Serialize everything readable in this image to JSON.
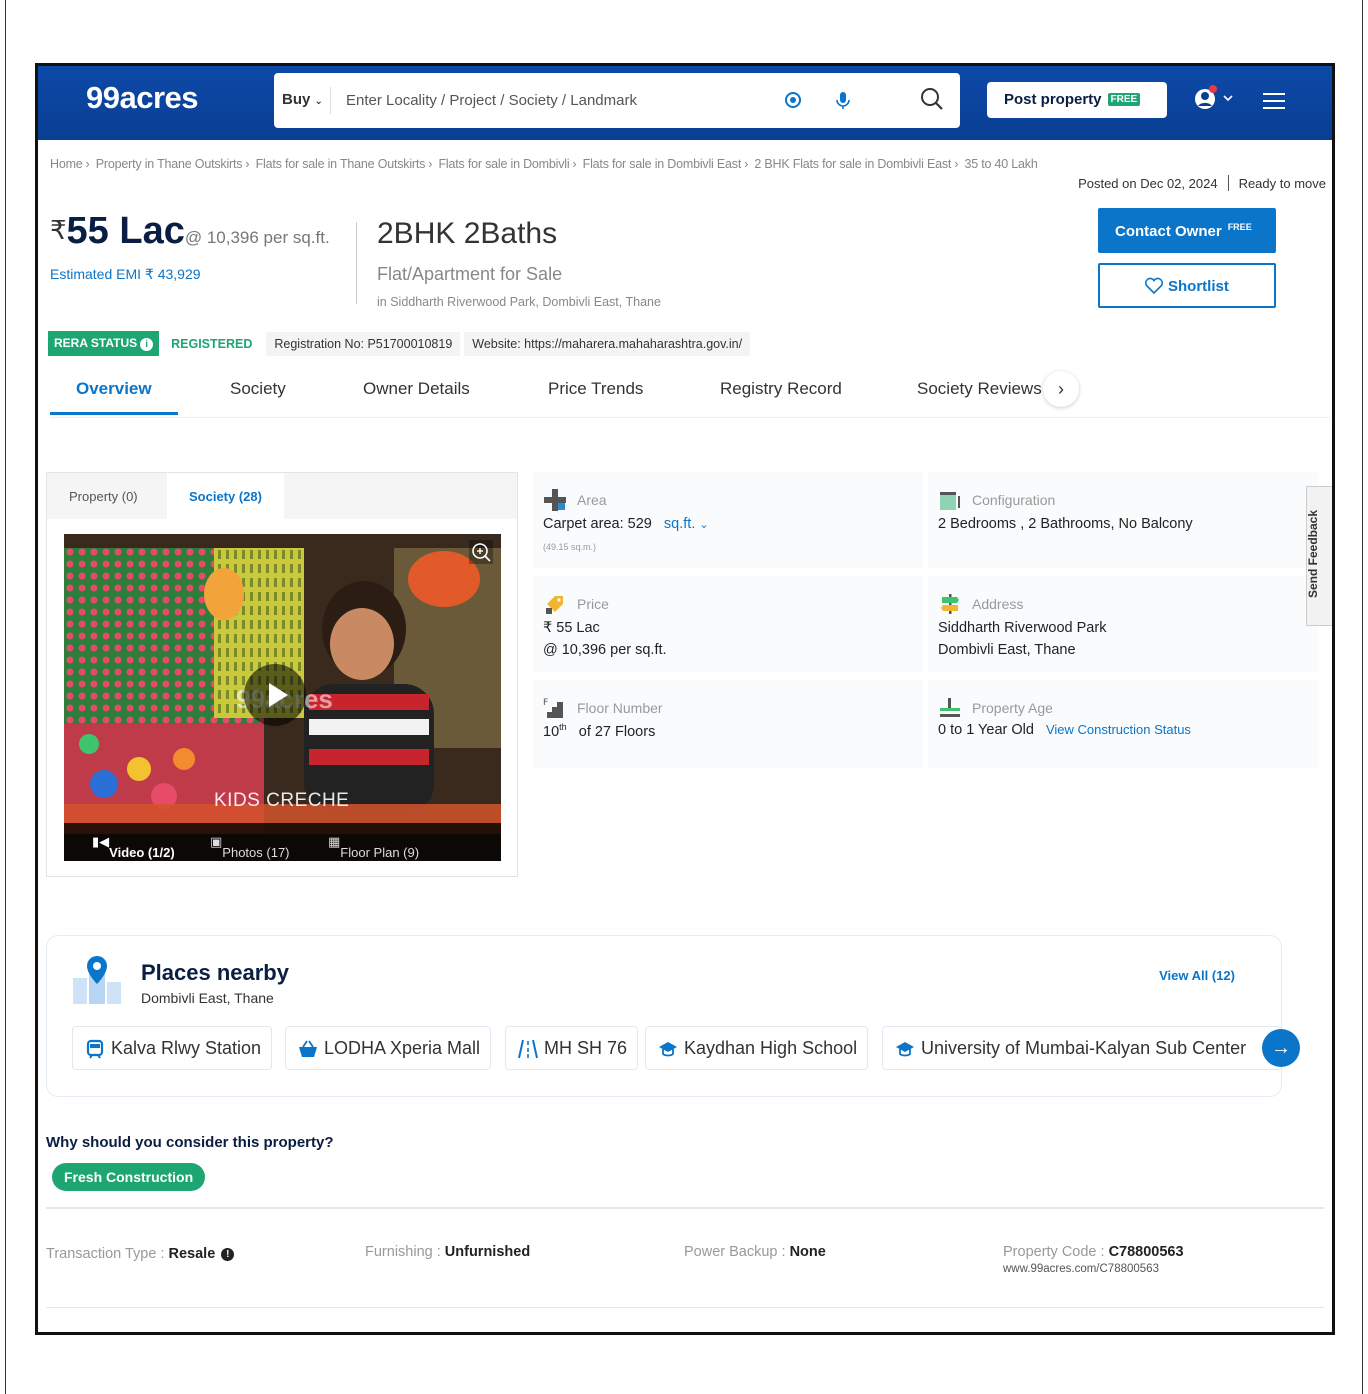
{
  "header": {
    "logo": "99acres",
    "buy_label": "Buy",
    "search_placeholder": "Enter Locality / Project / Society / Landmark",
    "post_property": "Post property",
    "free_tag": "FREE"
  },
  "breadcrumbs": [
    "Home",
    "Property in Thane Outskirts",
    "Flats for sale in Thane Outskirts",
    "Flats for sale in Dombivli",
    "Flats for sale in Dombivli East",
    "2 BHK Flats for sale in Dombivli East",
    "35 to 40 Lakh"
  ],
  "posted": {
    "date": "Posted on Dec 02, 2024",
    "status": "Ready to move"
  },
  "listing": {
    "currency": "₹",
    "price": "55 Lac",
    "per_sqft": "@ 10,396 per sq.ft.",
    "emi": "Estimated EMI ₹ 43,929",
    "title": "2BHK 2Baths",
    "subtitle": "Flat/Apartment for Sale",
    "location": "in Siddharth Riverwood Park, Dombivli East, Thane",
    "contact_btn": "Contact Owner",
    "contact_free": "FREE",
    "shortlist_btn": "Shortlist"
  },
  "rera": {
    "badge": "RERA STATUS",
    "status": "REGISTERED",
    "registration": "Registration No: P51700010819",
    "website": "Website: https://maharera.mahaharashtra.gov.in/"
  },
  "tabs": [
    "Overview",
    "Society",
    "Owner Details",
    "Price Trends",
    "Registry Record",
    "Society Reviews"
  ],
  "media": {
    "tabs": [
      "Property (0)",
      "Society (28)"
    ],
    "overlay_text": "KIDS CRECHE",
    "watermark": "99acres",
    "bar": [
      "Video (1/2)",
      "Photos (17)",
      "Floor Plan (9)"
    ]
  },
  "details": {
    "area": {
      "label": "Area",
      "value": "Carpet area: 529",
      "unit": "sq.ft.",
      "sub": "(49.15 sq.m.)"
    },
    "configuration": {
      "label": "Configuration",
      "value": "2 Bedrooms , 2 Bathrooms, No Balcony"
    },
    "price": {
      "label": "Price",
      "line1": "₹ 55 Lac",
      "line2": "@ 10,396 per sq.ft."
    },
    "address": {
      "label": "Address",
      "line1": "Siddharth Riverwood Park",
      "line2": "Dombivli East, Thane"
    },
    "floor": {
      "label": "Floor Number",
      "floor": "10",
      "floor_sup": "th",
      "of": "of 27 Floors"
    },
    "age": {
      "label": "Property Age",
      "value": "0 to 1 Year Old",
      "link": "View Construction Status"
    }
  },
  "feedback": "Send Feedback",
  "places": {
    "title": "Places nearby",
    "subtitle": "Dombivli East, Thane",
    "view_all": "View All (12)",
    "items": [
      "Kalva Rlwy Station",
      "LODHA Xperia Mall",
      "MH SH 76",
      "Kaydhan High School",
      "University of Mumbai-Kalyan Sub Center"
    ]
  },
  "why": {
    "question": "Why should you consider this property?",
    "tag": "Fresh Construction"
  },
  "facts": {
    "transaction_label": "Transaction Type : ",
    "transaction_value": "Resale",
    "furnishing_label": "Furnishing : ",
    "furnishing_value": "Unfurnished",
    "power_label": "Power Backup : ",
    "power_value": "None",
    "code_label": "Property Code : ",
    "code_value": "C78800563",
    "code_url": "www.99acres.com/C78800563"
  }
}
